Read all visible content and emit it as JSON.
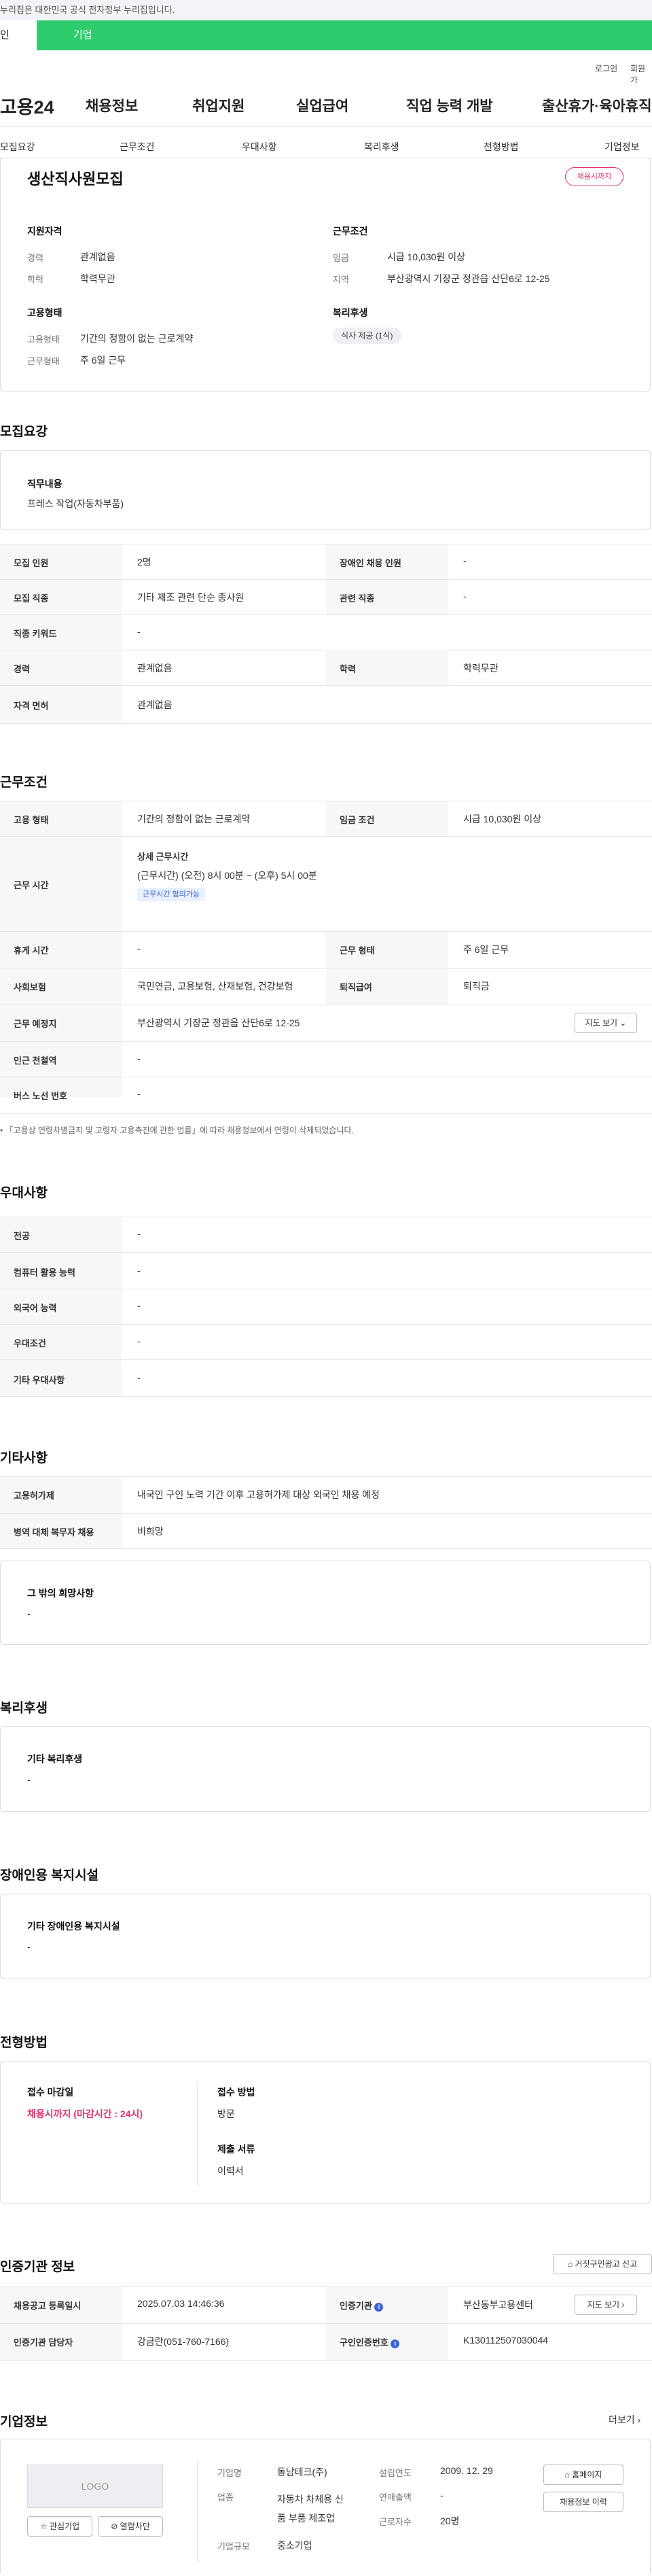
{
  "gov_banner": "누리집은 대한민국 공식 전자정부 누리집입니다.",
  "top_tabs": {
    "personal": "인",
    "company": "기업"
  },
  "util": {
    "login": "로그인",
    "signup": "회원가"
  },
  "site_logo": "고용24",
  "gnb": [
    "채용정보",
    "취업지원",
    "실업급여",
    "직업 능력 개발",
    "출산휴가·육아휴직"
  ],
  "lnb": [
    "모집요강",
    "근무조건",
    "우대사항",
    "복리후생",
    "전형방법",
    "기업정보"
  ],
  "summary": {
    "title": "생산직사원모집",
    "badge": "채용시까지",
    "qual_title": "지원자격",
    "career_label": "경력",
    "career_value": "관계없음",
    "edu_label": "학력",
    "edu_value": "학력무관",
    "cond_title": "근무조건",
    "wage_label": "임금",
    "wage_value": "시급 10,030원 이상",
    "area_label": "지역",
    "area_value": "부산광역시 기장군 정관읍 산단6로 12-25",
    "emp_title": "고용형태",
    "emptype_label": "고용형태",
    "emptype_value": "기간의 정함이 없는 근로계약",
    "worktype_label": "근무형태",
    "worktype_value": "주 6일 근무",
    "welfare_title": "복리후생",
    "welfare_chip": "식사 제공 (1식)"
  },
  "recruit": {
    "section_title": "모집요강",
    "duty_title": "직무내용",
    "duty_value": "프레스 작업(자동차부품)",
    "rows": {
      "count_label": "모집 인원",
      "count_value": "2명",
      "disabled_label": "장애인 채용 인원",
      "disabled_value": "-",
      "job_label": "모집 직종",
      "job_value": "기타 제조 관련 단순 종사원",
      "related_label": "관련 직종",
      "related_value": "-",
      "keyword_label": "직종 키워드",
      "keyword_value": "-",
      "career_label": "경력",
      "career_value": "관계없음",
      "edu_label": "학력",
      "edu_value": "학력무관",
      "license_label": "자격 면허",
      "license_value": "관계없음"
    }
  },
  "conditions": {
    "section_title": "근무조건",
    "emptype_label": "고용 형태",
    "emptype_value": "기간의 정함이 없는 근로계약",
    "wage_label": "임금 조건",
    "wage_value": "시급 10,030원 이상",
    "hours_label": "근무 시간",
    "hours_title": "상세 근무시간",
    "hours_value": "(근무시간) (오전) 8시 00분 ~ (오후) 5시 00분",
    "hours_chip": "근무시간 협의가능",
    "break_label": "휴게 시간",
    "break_value": "-",
    "worktype_label": "근무 형태",
    "worktype_value": "주 6일 근무",
    "insurance_label": "사회보험",
    "insurance_value": "국민연금, 고용보험, 산재보험, 건강보험",
    "severance_label": "퇴직급여",
    "severance_value": "퇴직금",
    "place_label": "근무 예정지",
    "place_value": "부산광역시 기장군 정관읍 산단6로 12-25",
    "map_button": "지도 보기",
    "subway_label": "인근 전철역",
    "subway_value": "-",
    "bus_label": "버스 노선 번호",
    "bus_value": "-",
    "note": "「고용상 연령차별금지 및 고령자 고용촉진에 관한 법률」에 따라 채용정보에서 연령이 삭제되었습니다."
  },
  "preference": {
    "section_title": "우대사항",
    "major_label": "전공",
    "major_value": "-",
    "computer_label": "컴퓨터 활용 능력",
    "computer_value": "-",
    "language_label": "외국어 능력",
    "language_value": "-",
    "pref_label": "우대조건",
    "pref_value": "-",
    "etc_label": "기타 우대사항",
    "etc_value": "-"
  },
  "etc": {
    "section_title": "기타사항",
    "permit_label": "고용허가제",
    "permit_value": "내국인 구인 노력 기간 이후 고용허가제 대상 외국인 채용 예정",
    "military_label": "병역 대체 복무자 채용",
    "military_value": "비희망",
    "wish_title": "그 밖의 희망사항",
    "wish_value": "-"
  },
  "welfare": {
    "section_title": "복리후생",
    "etc_title": "기타 복리후생",
    "etc_value": "-"
  },
  "disabled": {
    "section_title": "장애인용 복지시설",
    "etc_title": "기타 장애인용 복지시설",
    "etc_value": "-"
  },
  "selection": {
    "section_title": "전형방법",
    "deadline_title": "접수 마감일",
    "deadline_value": "채용시까지 (마감시간 : 24시)",
    "method_title": "접수 방법",
    "method_value": "방문",
    "docs_title": "제출 서류",
    "docs_value": "이력서"
  },
  "agency": {
    "section_title": "인증기관 정보",
    "report_button": "거짓구인광고 신고",
    "reg_label": "채용공고 등록일시",
    "reg_value": "2025.07.03 14:46:36",
    "org_label": "인증기관",
    "org_value": "부산동부고용센터",
    "map_button": "지도 보기",
    "manager_label": "인증기관 담당자",
    "manager_value": "강금란(051-760-7166)",
    "reqno_label": "구인인증번호",
    "reqno_value": "K130112507030044"
  },
  "company": {
    "section_title": "기업정보",
    "more": "더보기",
    "logo_placeholder": "LOGO",
    "fav_button": "관심기업",
    "block_button": "열람차단",
    "name_label": "기업명",
    "name_value": "동남테크(주)",
    "industry_label": "업종",
    "industry_value": "자동차 차체용 신품 부품 제조업",
    "size_label": "기업규모",
    "size_value": "중소기업",
    "founded_label": "설립연도",
    "founded_value": "2009. 12. 29",
    "sales_label": "연매출액",
    "sales_value": "-",
    "employees_label": "근로자수",
    "employees_value": "20명",
    "homepage_button": "홈페이지",
    "list_button": "채용정보 이력"
  }
}
